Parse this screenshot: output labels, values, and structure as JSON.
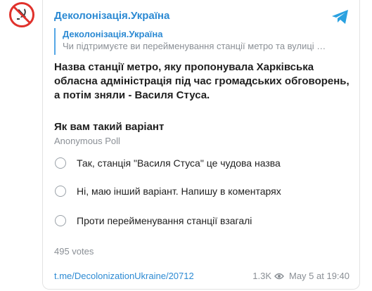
{
  "avatar": {
    "icon": "no-soviet-symbol-icon",
    "color": "#e0312b"
  },
  "channel": {
    "title": "Деколонізація.Україна"
  },
  "reply": {
    "title": "Деколонізація.Україна",
    "text": "Чи підтримуєте ви перейменування станції метро та вулиці …"
  },
  "message": {
    "text": "Назва станції метро, яку пропонувала Харківська обласна адміністрація під час громадських обговорень, а потім зняли - Василя Стуса."
  },
  "poll": {
    "question": "Як вам такий варіант",
    "type": "Anonymous Poll",
    "options": [
      {
        "label": "Так, станція \"Василя Стуса\" це чудова назва"
      },
      {
        "label": "Ні, маю інший варіант. Напишу в коментарях"
      },
      {
        "label": "Проти перейменування станції взагалі"
      }
    ],
    "votes": "495 votes"
  },
  "footer": {
    "link": "t.me/DecolonizationUkraine/20712",
    "views": "1.3K",
    "date": "May 5 at 19:40"
  },
  "colors": {
    "accent": "#2c8ad3",
    "telegram": "#2aa1e0"
  }
}
